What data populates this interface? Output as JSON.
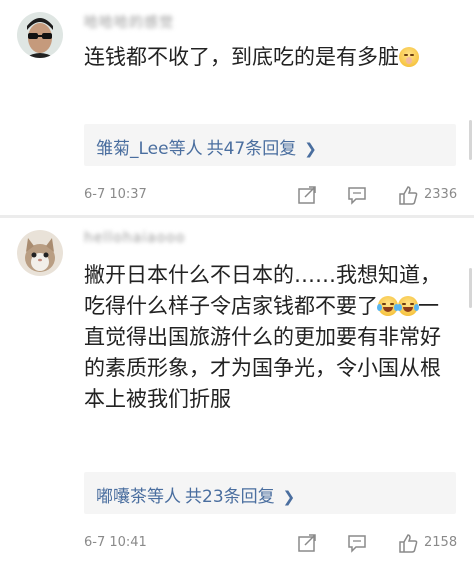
{
  "comments": [
    {
      "username": "哈哈哈的感觉",
      "text_before_emoji": "连钱都不收了，到底吃的是有多脏",
      "emoji": "shushing-face-emoji",
      "replies": {
        "names": "雏菊_Lee等人",
        "count_text": "共47条回复"
      },
      "time": "6-7 10:37",
      "likes": "2336"
    },
    {
      "username": "hellohaiaooo",
      "text_line_1": "撇开日本什么不日本的……我想知道，吃得什么样子令店家钱都不要了",
      "text_line_2": "一直觉得出国旅游什么的更加要有非常好的素质形象，才为国争光，令小国从根本上被我们折服",
      "emoji": "tears-of-joy-emoji",
      "replies": {
        "names": "嘟囔茶等人",
        "count_text": "共23条回复"
      },
      "time": "6-7 10:41",
      "likes": "2158"
    }
  ],
  "colors": {
    "link": "#4a6e9f",
    "meta": "#8a8a8a",
    "text": "#222222",
    "reply_bg": "#f5f5f5"
  },
  "icons": [
    "share-icon",
    "comment-icon",
    "like-icon",
    "chevron-right-icon"
  ]
}
